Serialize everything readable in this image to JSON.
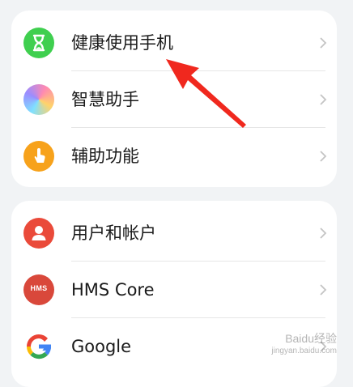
{
  "groups": [
    {
      "items": [
        {
          "label": "健康使用手机",
          "icon": "hourglass-icon",
          "color": "#3fcf4f"
        },
        {
          "label": "智慧助手",
          "icon": "smart-assistant-icon",
          "color": "#b58cff"
        },
        {
          "label": "辅助功能",
          "icon": "hand-pointer-icon",
          "color": "#f7a21b"
        }
      ]
    },
    {
      "items": [
        {
          "label": "用户和帐户",
          "icon": "user-icon",
          "color": "#ea4a3a"
        },
        {
          "label": "HMS Core",
          "icon": "hms-icon",
          "icon_text": "HMS",
          "color": "#d9483b"
        },
        {
          "label": "Google",
          "icon": "google-icon",
          "color": "#4285f4"
        }
      ]
    }
  ],
  "annotation": {
    "arrow_color": "#f0281e"
  },
  "watermark": {
    "line1": "Baidu经验",
    "line2": "jingyan.baidu.com"
  }
}
